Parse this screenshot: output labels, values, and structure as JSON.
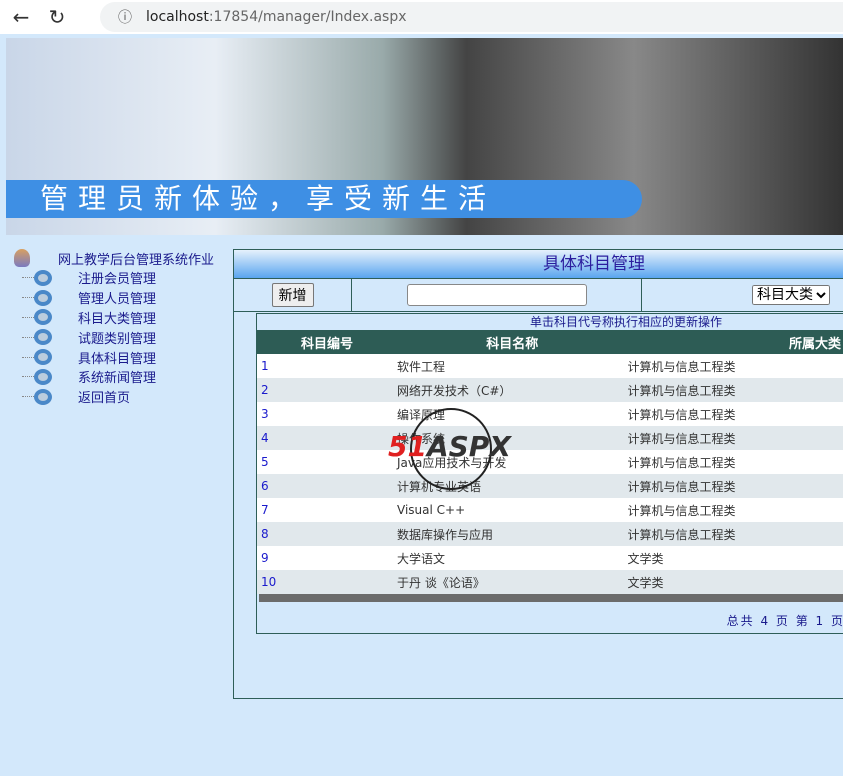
{
  "browser": {
    "url_host": "localhost",
    "url_path": ":17854/manager/Index.aspx"
  },
  "banner": {
    "slogan": "管理员新体验，享受新生活"
  },
  "sidebar": {
    "root": "网上教学后台管理系统作业",
    "items": [
      "注册会员管理",
      "管理人员管理",
      "科目大类管理",
      "试题类别管理",
      "具体科目管理",
      "系统新闻管理",
      "返回首页"
    ]
  },
  "main": {
    "title": "具体科目管理",
    "add_label": "新增",
    "search_value": "",
    "category_select": "科目大类",
    "hint": "单击科目代号称执行相应的更新操作",
    "columns": [
      "科目编号",
      "科目名称",
      "所属大类"
    ],
    "rows": [
      {
        "id": "1",
        "name": "软件工程",
        "cat": "计算机与信息工程类"
      },
      {
        "id": "2",
        "name": "网络开发技术（C#）",
        "cat": "计算机与信息工程类"
      },
      {
        "id": "3",
        "name": "编译原理",
        "cat": "计算机与信息工程类"
      },
      {
        "id": "4",
        "name": "操作系统",
        "cat": "计算机与信息工程类"
      },
      {
        "id": "5",
        "name": "Java应用技术与开发",
        "cat": "计算机与信息工程类"
      },
      {
        "id": "6",
        "name": "计算机专业英语",
        "cat": "计算机与信息工程类"
      },
      {
        "id": "7",
        "name": "Visual C++",
        "cat": "计算机与信息工程类"
      },
      {
        "id": "8",
        "name": "数据库操作与应用",
        "cat": "计算机与信息工程类"
      },
      {
        "id": "9",
        "name": "大学语文",
        "cat": "文学类"
      },
      {
        "id": "10",
        "name": "于丹 谈《论语》",
        "cat": "文学类"
      }
    ],
    "pager": "总共 4 页 第 1 页"
  },
  "watermark": "51ASPX"
}
